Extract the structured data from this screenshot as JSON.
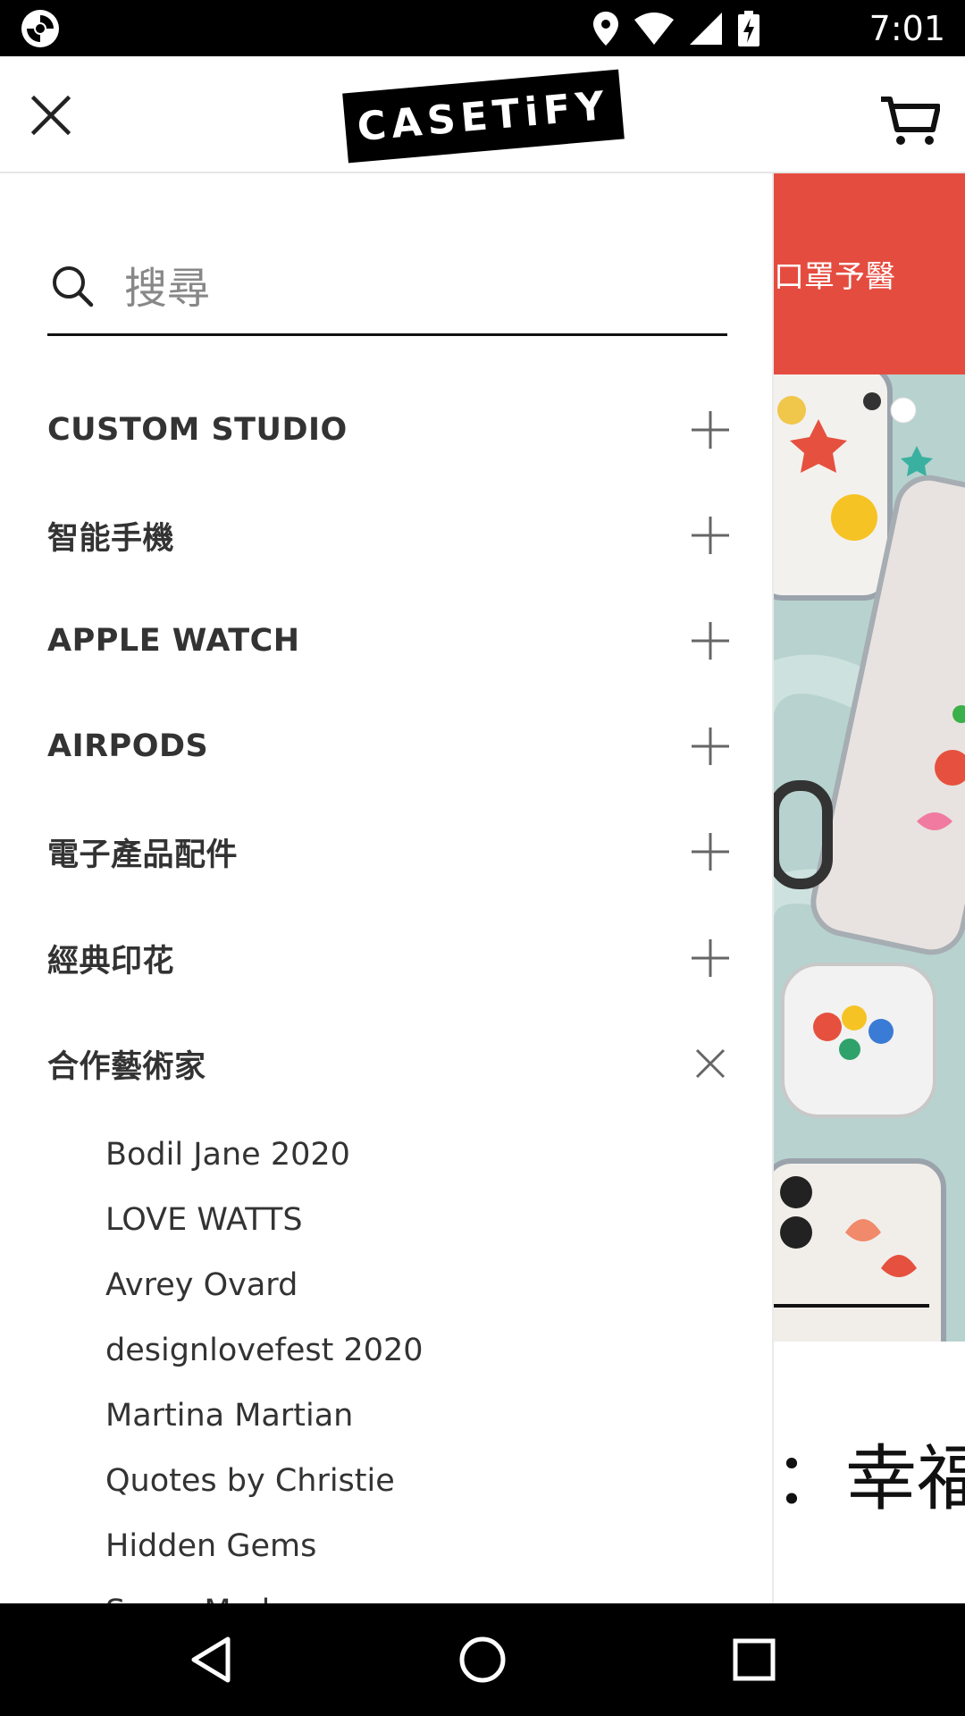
{
  "status_bar": {
    "time": "7:01",
    "icons": [
      "location-icon",
      "wifi-icon",
      "signal-icon",
      "battery-charging-icon"
    ]
  },
  "header": {
    "logo_text": "CASETiFY",
    "close_icon": "close-icon",
    "cart_icon": "cart-icon"
  },
  "search": {
    "placeholder": "搜尋",
    "value": ""
  },
  "menu": {
    "items": [
      {
        "label": "CUSTOM STUDIO",
        "toggle": "+"
      },
      {
        "label": "智能手機",
        "toggle": "+"
      },
      {
        "label": "APPLE WATCH",
        "toggle": "+"
      },
      {
        "label": "AIRPODS",
        "toggle": "+"
      },
      {
        "label": "電子產品配件",
        "toggle": "+"
      },
      {
        "label": "經典印花",
        "toggle": "+"
      },
      {
        "label": "合作藝術家",
        "toggle": "×"
      }
    ],
    "sub_items": [
      "Bodil Jane 2020",
      "LOVE WATTS",
      "Avrey Ovard",
      "designlovefest 2020",
      "Martina Martian",
      "Quotes by Christie",
      "Hidden Gems",
      "Sama Mode"
    ]
  },
  "background": {
    "banner_text": "口罩予醫",
    "bottom_text": "：幸福"
  },
  "colors": {
    "banner": "#e54c40",
    "text": "#333333",
    "accent_black": "#000000"
  }
}
